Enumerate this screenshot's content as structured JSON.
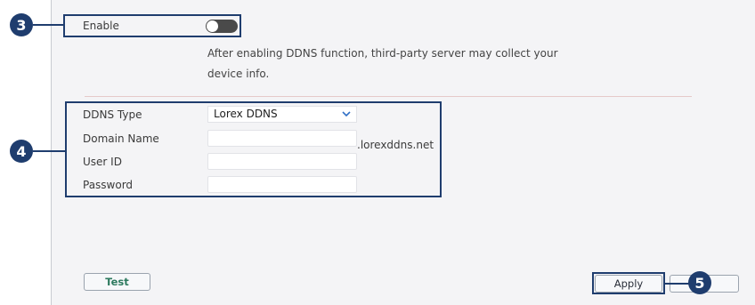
{
  "enable": {
    "label": "Enable",
    "state": "off"
  },
  "notice": {
    "line1": "After enabling DDNS function, third-party server may collect your",
    "line2": "device info."
  },
  "form": {
    "ddns_type": {
      "label": "DDNS Type",
      "value": "Lorex DDNS"
    },
    "domain_name": {
      "label": "Domain Name",
      "value": "",
      "suffix": ".lorexddns.net"
    },
    "user_id": {
      "label": "User ID",
      "value": ""
    },
    "password": {
      "label": "Password",
      "value": ""
    }
  },
  "buttons": {
    "test": "Test",
    "apply": "Apply",
    "cancel": ""
  },
  "callouts": {
    "enable": "3",
    "form": "4",
    "apply": "5"
  },
  "colors": {
    "callout": "#1f3d6e",
    "panel_bg": "#f4f4f6",
    "test_text": "#2e7a5f"
  }
}
